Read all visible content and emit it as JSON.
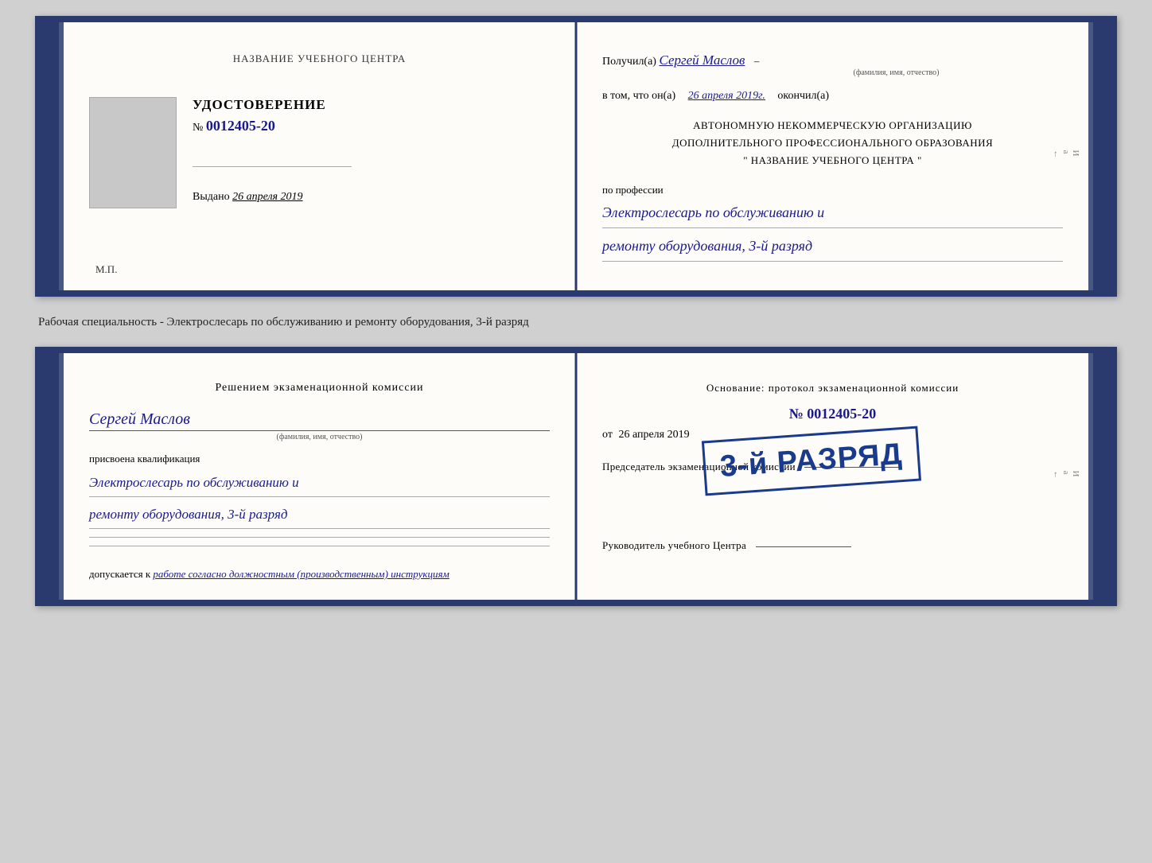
{
  "card1": {
    "left": {
      "title": "НАЗВАНИЕ УЧЕБНОГО ЦЕНТРА",
      "cert_word": "УДОСТОВЕРЕНИЕ",
      "cert_number_prefix": "№",
      "cert_number": "0012405-20",
      "issued_label": "Выдано",
      "issued_date": "26 апреля 2019",
      "mp_label": "М.П."
    },
    "right": {
      "received_label": "Получил(а)",
      "recipient_name": "Сергей Маслов",
      "name_subtitle": "(фамилия, имя, отчество)",
      "in_that_label": "в том, что он(а)",
      "date_value": "26 апреля 2019г.",
      "finished_label": "окончил(а)",
      "org_line1": "АВТОНОМНУЮ НЕКОММЕРЧЕСКУЮ ОРГАНИЗАЦИЮ",
      "org_line2": "ДОПОЛНИТЕЛЬНОГО ПРОФЕССИОНАЛЬНОГО ОБРАЗОВАНИЯ",
      "org_line3": "\"    НАЗВАНИЕ УЧЕБНОГО ЦЕНТРА    \"",
      "profession_label": "по профессии",
      "profession_line1": "Электрослесарь по обслуживанию и",
      "profession_line2": "ремонту оборудования, 3-й разряд"
    }
  },
  "between_text": "Рабочая специальность - Электрослесарь по обслуживанию и ремонту оборудования, 3-й разряд",
  "card2": {
    "left": {
      "commission_title": "Решением экзаменационной  комиссии",
      "person_name": "Сергей Маслов",
      "fio_subtitle": "(фамилия, имя, отчество)",
      "assigned_label": "присвоена квалификация",
      "qual_line1": "Электрослесарь по обслуживанию и",
      "qual_line2": "ремонту оборудования, 3-й разряд",
      "admission_label": "допускается к",
      "admission_text": "работе согласно должностным (производственным) инструкциям"
    },
    "right": {
      "basis_title": "Основание: протокол экзаменационной  комиссии",
      "basis_number_prefix": "№",
      "basis_number": "0012405-20",
      "date_prefix": "от",
      "basis_date": "26 апреля 2019",
      "chairman_label": "Председатель экзаменационной комиссии",
      "stamp_text": "3-й РАЗРЯД",
      "director_label": "Руководитель учебного Центра"
    }
  }
}
